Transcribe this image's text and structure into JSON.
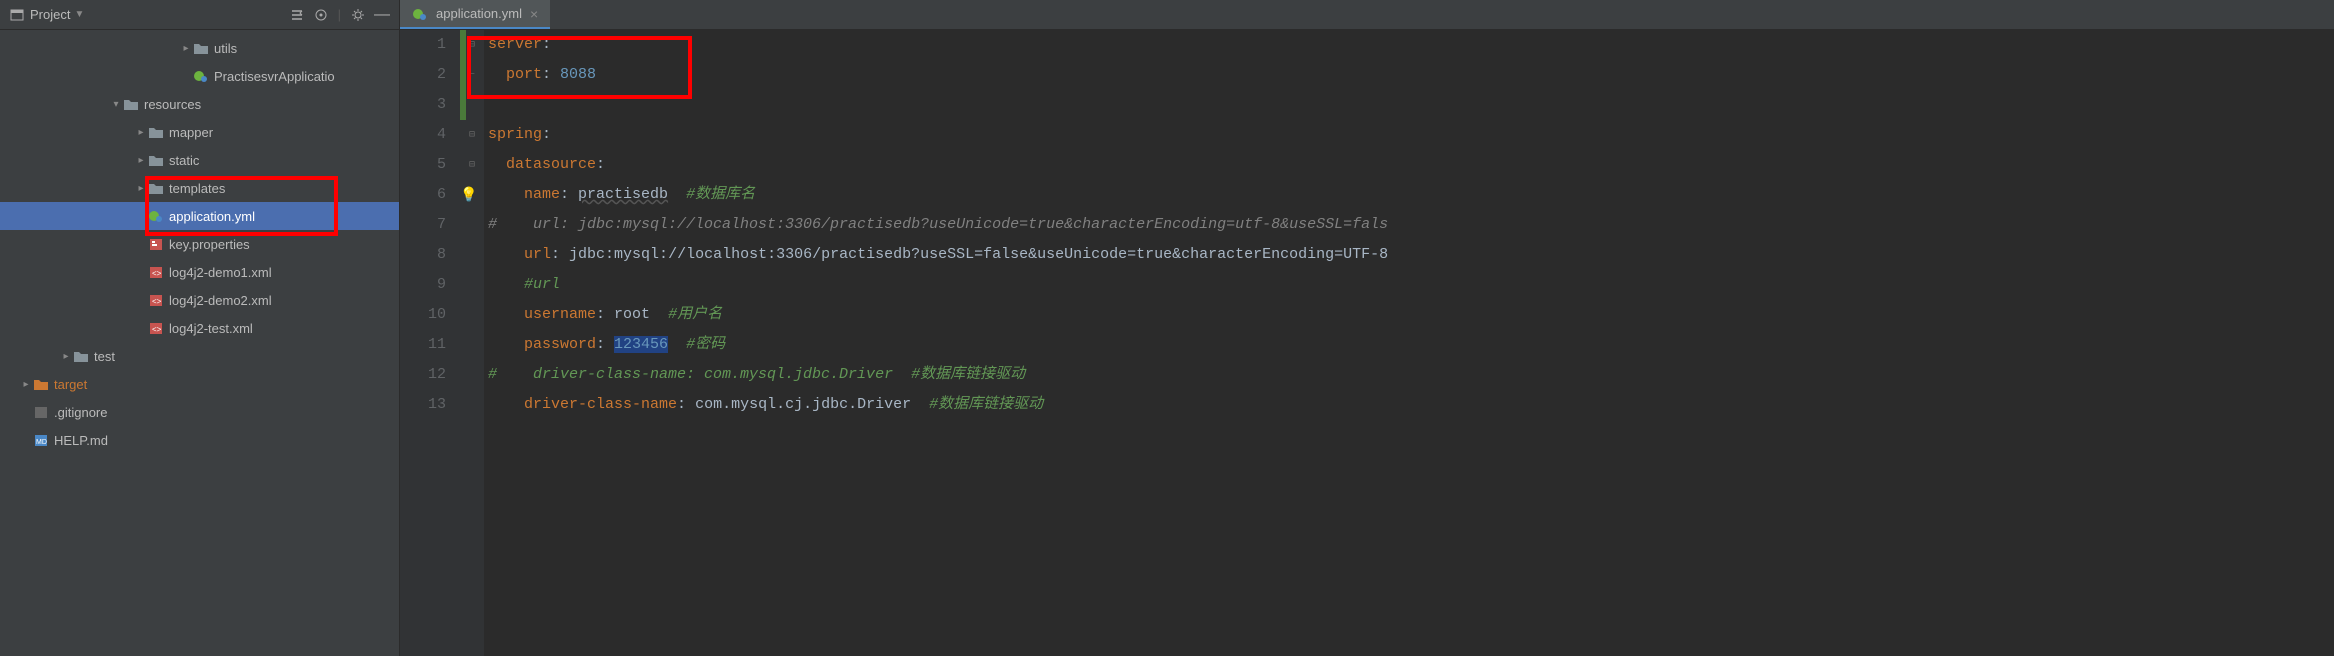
{
  "sidebar": {
    "title": "Project",
    "tree": [
      {
        "indent": 6,
        "icon": "chevron-right",
        "type": "folder",
        "label": "utils"
      },
      {
        "indent": 6,
        "icon": "none",
        "type": "class-spring",
        "label": "PractisesvrApplicatio"
      },
      {
        "indent": 3,
        "icon": "chevron-down",
        "type": "folder",
        "label": "resources"
      },
      {
        "indent": 4,
        "icon": "chevron-right",
        "type": "folder",
        "label": "mapper"
      },
      {
        "indent": 4,
        "icon": "chevron-right",
        "type": "folder",
        "label": "static"
      },
      {
        "indent": 4,
        "icon": "chevron-right",
        "type": "folder",
        "label": "templates"
      },
      {
        "indent": 4,
        "icon": "none",
        "type": "yaml-file",
        "label": "application.yml",
        "selected": true
      },
      {
        "indent": 4,
        "icon": "none",
        "type": "prop-file",
        "label": "key.properties"
      },
      {
        "indent": 4,
        "icon": "none",
        "type": "xml-file",
        "label": "log4j2-demo1.xml"
      },
      {
        "indent": 4,
        "icon": "none",
        "type": "xml-file",
        "label": "log4j2-demo2.xml"
      },
      {
        "indent": 4,
        "icon": "none",
        "type": "xml-file",
        "label": "log4j2-test.xml"
      },
      {
        "indent": 1,
        "icon": "chevron-right",
        "type": "folder",
        "label": "test"
      },
      {
        "indent": 0,
        "icon": "chevron-right",
        "type": "folder-orange",
        "label": "target",
        "orange": true
      },
      {
        "indent": 0,
        "icon": "none",
        "type": "git-file",
        "label": ".gitignore"
      },
      {
        "indent": 0,
        "icon": "none",
        "type": "md-file",
        "label": "HELP.md"
      }
    ]
  },
  "editor": {
    "tab": {
      "label": "application.yml"
    },
    "lines": {
      "l1_key": "server",
      "l1_colon": ":",
      "l2_key": "port",
      "l2_colon": ": ",
      "l2_val": "8088",
      "l4_key": "spring",
      "l4_colon": ":",
      "l5_key": "datasource",
      "l5_colon": ":",
      "l6_key": "name",
      "l6_colon": ": ",
      "l6_val": "practisedb",
      "l6_comment": "  #数据库名",
      "l7_comment": "#    url: jdbc:mysql://localhost:3306/practisedb?useUnicode=true&characterEncoding=utf-8&useSSL=fals",
      "l8_key": "url",
      "l8_colon": ": ",
      "l8_val": "jdbc:mysql://localhost:3306/practisedb?useSSL=false&useUnicode=true&characterEncoding=UTF-8",
      "l9_comment": "#url",
      "l10_key": "username",
      "l10_colon": ": ",
      "l10_val": "root",
      "l10_comment": "  #用户名",
      "l11_key": "password",
      "l11_colon": ": ",
      "l11_val": "123456",
      "l11_comment": "  #密码",
      "l12_comment": "#    driver-class-name: com.mysql.jdbc.Driver  #数据库链接驱动",
      "l13_key": "driver-class-name",
      "l13_colon": ": ",
      "l13_val": "com.mysql.cj.jdbc.Driver",
      "l13_comment": "  #数据库链接驱动"
    },
    "line_numbers": [
      "1",
      "2",
      "3",
      "4",
      "5",
      "6",
      "7",
      "8",
      "9",
      "10",
      "11",
      "12",
      "13"
    ]
  }
}
